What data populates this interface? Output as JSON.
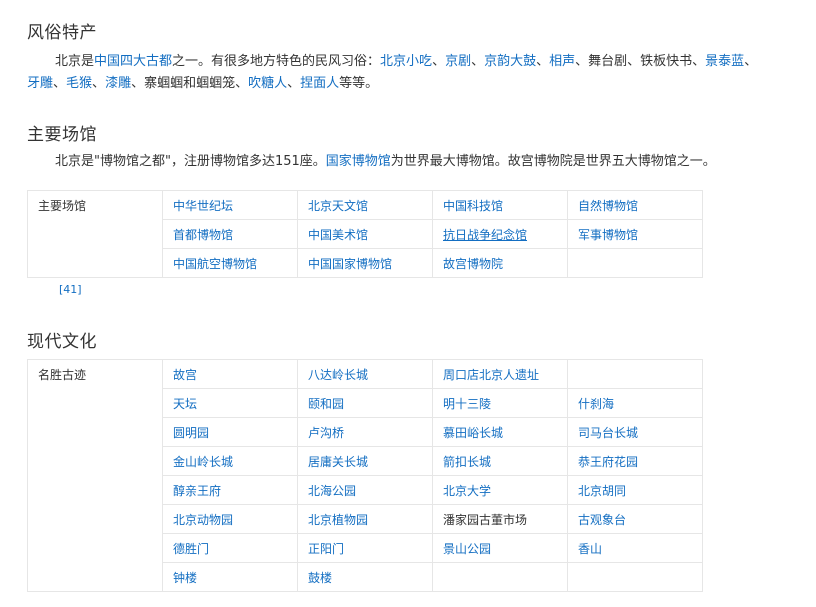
{
  "section1": {
    "heading": "风俗特产",
    "line1": [
      {
        "t": "北京是",
        "link": false
      },
      {
        "t": "中国四大古都",
        "link": true
      },
      {
        "t": "之一。有很多地方特色的民风习俗：",
        "link": false
      },
      {
        "t": "北京小吃",
        "link": true
      },
      {
        "t": "、",
        "link": false
      },
      {
        "t": "京剧",
        "link": true
      },
      {
        "t": "、",
        "link": false
      },
      {
        "t": "京韵大鼓",
        "link": true
      },
      {
        "t": "、",
        "link": false
      },
      {
        "t": "相声",
        "link": true
      },
      {
        "t": "、舞台剧、铁板快书、",
        "link": false
      },
      {
        "t": "景泰蓝",
        "link": true
      },
      {
        "t": "、",
        "link": false
      }
    ],
    "line2": [
      {
        "t": "牙雕",
        "link": true
      },
      {
        "t": "、",
        "link": false
      },
      {
        "t": "毛猴",
        "link": true
      },
      {
        "t": "、",
        "link": false
      },
      {
        "t": "漆雕",
        "link": true
      },
      {
        "t": "、寨蝈蝈和蝈蝈笼、",
        "link": false
      },
      {
        "t": "吹糖人",
        "link": true
      },
      {
        "t": "、",
        "link": false
      },
      {
        "t": "捏面人",
        "link": true
      },
      {
        "t": "等等。",
        "link": false
      }
    ]
  },
  "section2": {
    "heading": "主要场馆",
    "para": [
      {
        "t": "北京是\"博物馆之都\"，注册博物馆多达151座。",
        "link": false
      },
      {
        "t": "国家博物馆",
        "link": true
      },
      {
        "t": "为世界最大博物馆。故宫博物院是世界五大博物馆之一。",
        "link": false
      }
    ],
    "table_label": "主要场馆",
    "rows": [
      [
        "中华世纪坛",
        "北京天文馆",
        "中国科技馆",
        "自然博物馆"
      ],
      [
        "首都博物馆",
        "中国美术馆",
        "抗日战争纪念馆",
        "军事博物馆"
      ],
      [
        "中国航空博物馆",
        "中国国家博物馆",
        "故宫博物院",
        ""
      ]
    ],
    "underlined": "抗日战争纪念馆",
    "ref": "[41]"
  },
  "section3": {
    "heading": "现代文化",
    "table_label": "名胜古迹",
    "rows": [
      [
        "故宫",
        "八达岭长城",
        "周口店北京人遗址",
        ""
      ],
      [
        "天坛",
        "颐和园",
        "明十三陵",
        "什刹海"
      ],
      [
        "圆明园",
        "卢沟桥",
        "慕田峪长城",
        "司马台长城"
      ],
      [
        "金山岭长城",
        "居庸关长城",
        "箭扣长城",
        "恭王府花园"
      ],
      [
        "醇亲王府",
        "北海公园",
        "北京大学",
        "北京胡同"
      ],
      [
        "北京动物园",
        "北京植物园",
        "潘家园古董市场",
        "古观象台"
      ],
      [
        "德胜门",
        "正阳门",
        "景山公园",
        "香山"
      ],
      [
        "钟楼",
        "鼓楼",
        "",
        ""
      ]
    ],
    "dark_cells": [
      "潘家园古董市场"
    ]
  },
  "colors": {
    "link": "#136ec2",
    "text": "#333333",
    "border": "#e6e6e6"
  }
}
